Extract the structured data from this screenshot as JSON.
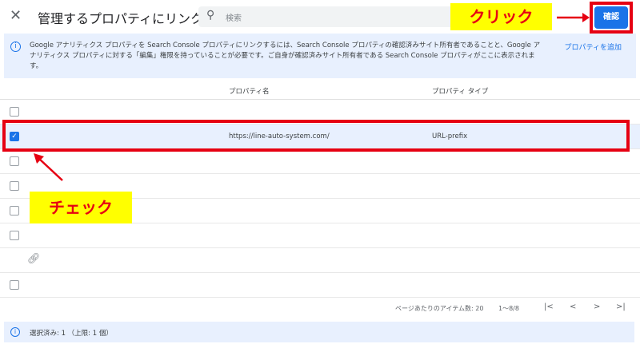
{
  "header": {
    "close_icon": "close-icon",
    "title": "管理するプロパティにリンク",
    "search_placeholder": "検索",
    "confirm_label": "確認"
  },
  "banner": {
    "text": "Google アナリティクス プロパティを Search Console プロパティにリンクするには、Search Console プロパティの確認済みサイト所有者であることと、Google アナリティクス プロパティに対する「編集」権限を持っていることが必要です。ご自身が確認済みサイト所有者である Search Console プロパティがここに表示されます。",
    "add_label": "プロパティを追加"
  },
  "table": {
    "columns": [
      "プロパティ名",
      "プロパティ タイプ"
    ],
    "rows": [
      {
        "name": "",
        "type": "",
        "checked": false
      },
      {
        "name": "https://line-auto-system.com/",
        "type": "URL-prefix",
        "checked": true
      },
      {
        "name": "",
        "type": "",
        "checked": false
      },
      {
        "name": "",
        "type": "",
        "checked": false
      },
      {
        "name": "",
        "type": "",
        "checked": false
      },
      {
        "name": "",
        "type": "",
        "checked": false
      },
      {
        "name": "",
        "type": "",
        "checked": false,
        "icon": "link-icon"
      },
      {
        "name": "",
        "type": "",
        "checked": false
      }
    ]
  },
  "pagination": {
    "per_page_label": "ページあたりのアイテム数: 20",
    "range": "1〜8/8",
    "first": "|<",
    "prev": "<",
    "next": ">",
    "last": ">|"
  },
  "status": {
    "selected": "選択済み: 1 （上限: 1 個）"
  },
  "annotations": {
    "click_label": "クリック",
    "check_label": "チェック",
    "color_red": "#e60012",
    "color_yellow": "#ffff00"
  }
}
